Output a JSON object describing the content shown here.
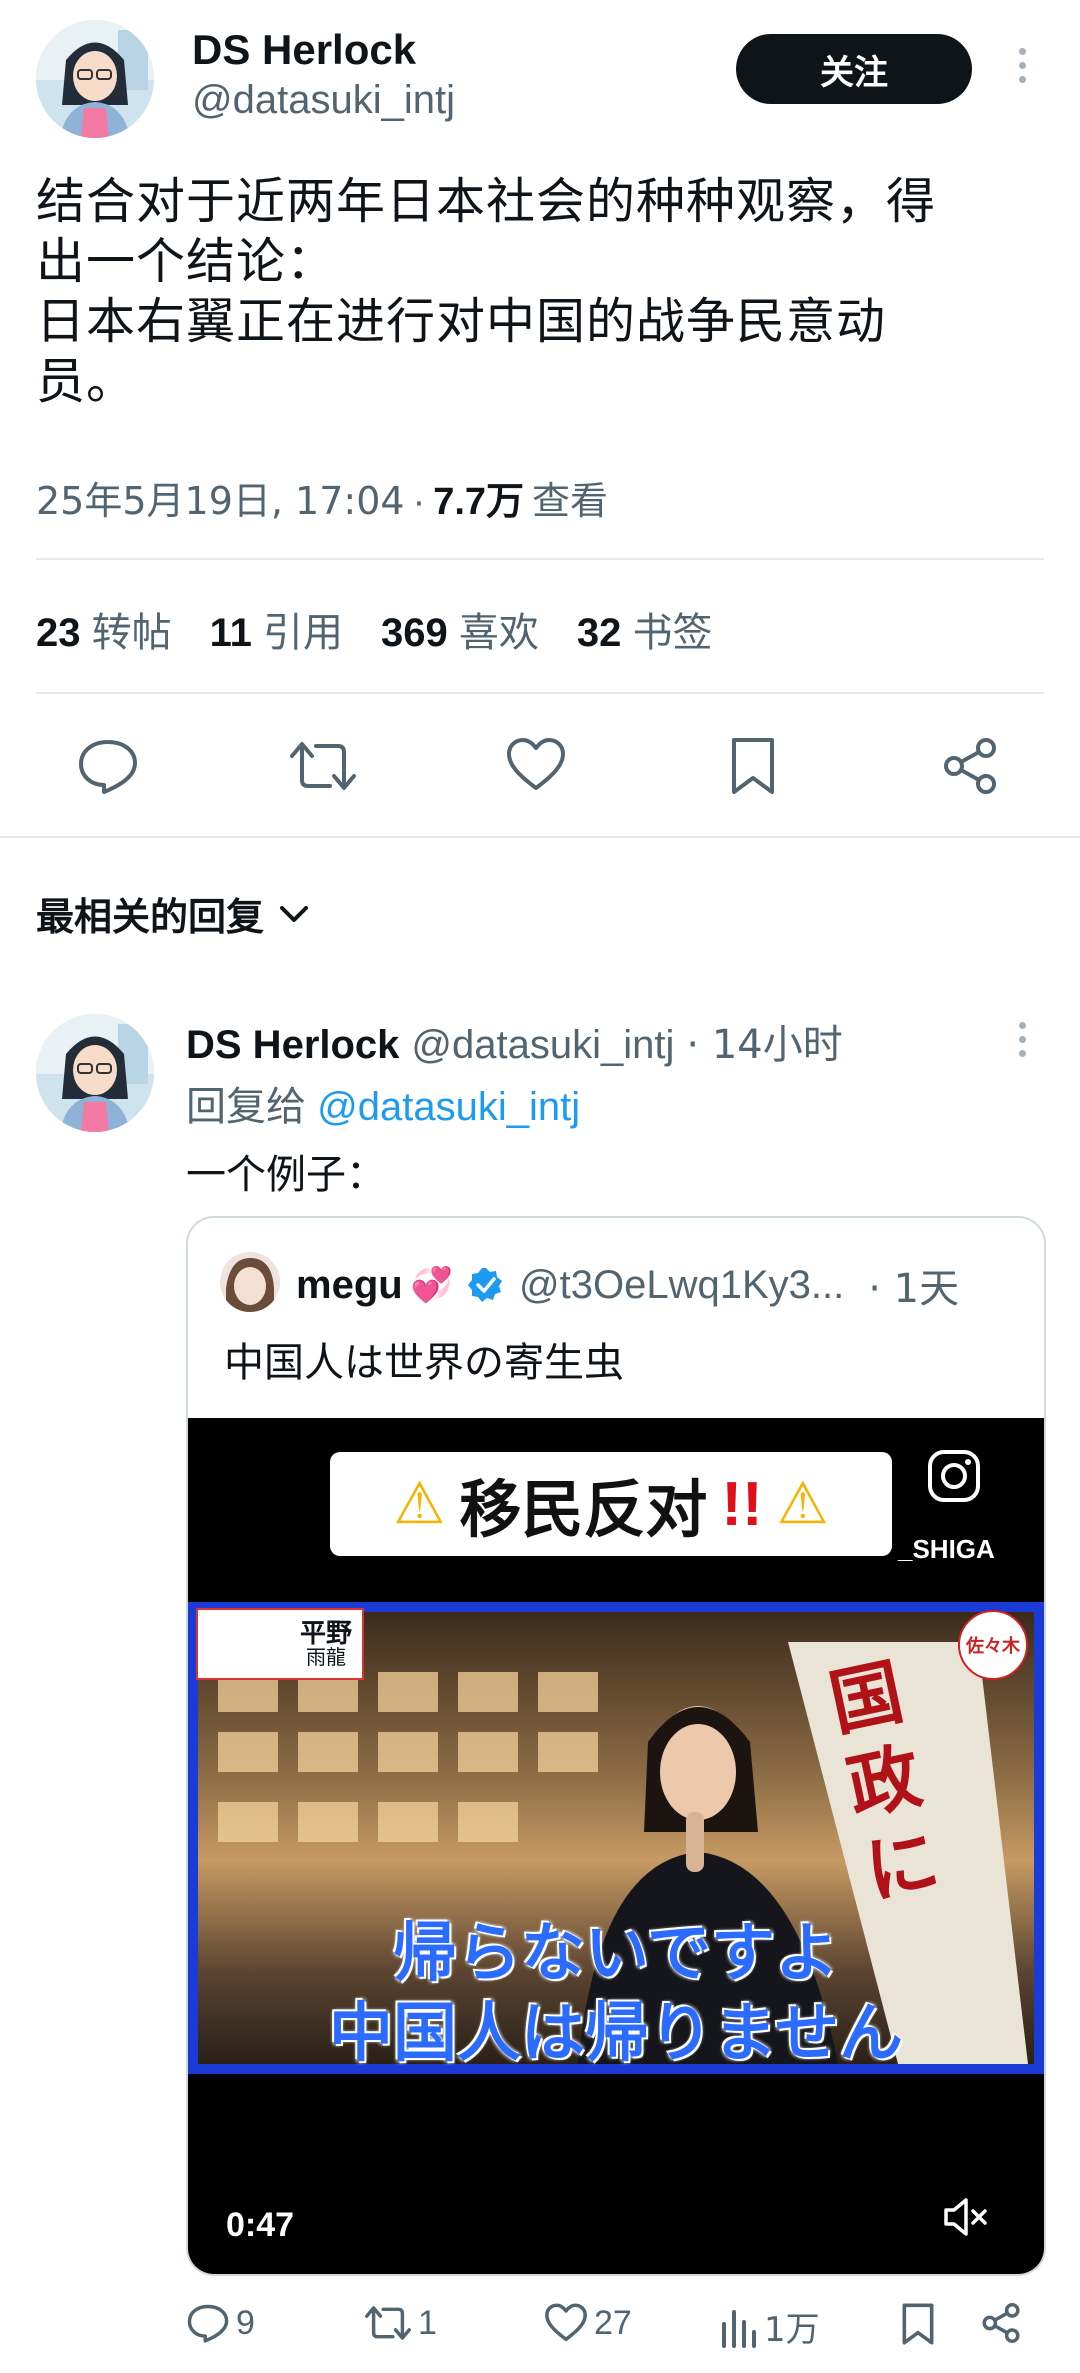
{
  "tweet": {
    "author_name": "DS Herlock",
    "author_handle": "@datasuki_intj",
    "follow_label": "关注",
    "text_lines": [
      "结合对于近两年日本社会的种种观察，得",
      "出一个结论：",
      "日本右翼正在进行对中国的战争民意动",
      "员。"
    ],
    "timestamp": "25年5月19日, 17:04",
    "separator": "·",
    "views_count": "7.7万",
    "views_label": "查看",
    "stats": [
      {
        "num": "23",
        "label": "转帖"
      },
      {
        "num": "11",
        "label": "引用"
      },
      {
        "num": "369",
        "label": "喜欢"
      },
      {
        "num": "32",
        "label": "书签"
      }
    ],
    "actions": [
      "reply-icon",
      "retweet-icon",
      "like-icon",
      "bookmark-icon",
      "share-icon"
    ]
  },
  "replies_header": {
    "label": "最相关的回复",
    "icon": "chevron-down-icon"
  },
  "reply": {
    "author_name": "DS Herlock",
    "author_handle": "@datasuki_intj",
    "time": "· 14小时",
    "reply_to_label": "回复给",
    "reply_to_handle": "@datasuki_intj",
    "text": "一个例子：",
    "quote": {
      "author_name": "megu",
      "author_emoji": "💞",
      "author_handle": "@t3OeLwq1Ky3...",
      "time": "· 1天",
      "text": "中国人は世界の寄生虫",
      "video": {
        "banner_text": "移民反对",
        "banner_marks": "!!",
        "warning_symbol": "⚠",
        "ig_handle": "_SHIGA",
        "caption_line1": "帰らないですよ",
        "caption_line2": "中国人は帰りません",
        "flag_text": "国政に",
        "name_tag_1": "平野",
        "name_tag_2": "雨龍",
        "corner_tag": "佐々木",
        "duration": "0:47"
      }
    },
    "actions": [
      {
        "icon": "reply-icon",
        "count": "9"
      },
      {
        "icon": "retweet-icon",
        "count": "1"
      },
      {
        "icon": "like-icon",
        "count": "27"
      },
      {
        "icon": "views-icon",
        "count": "1万"
      },
      {
        "icon": "bookmark-icon",
        "count": ""
      },
      {
        "icon": "share-icon",
        "count": ""
      }
    ]
  },
  "colors": {
    "text": "#0f1419",
    "muted": "#536471",
    "link": "#1d9bf0",
    "verified": "#1d9bf0",
    "video_frame": "#1a3bd6"
  }
}
